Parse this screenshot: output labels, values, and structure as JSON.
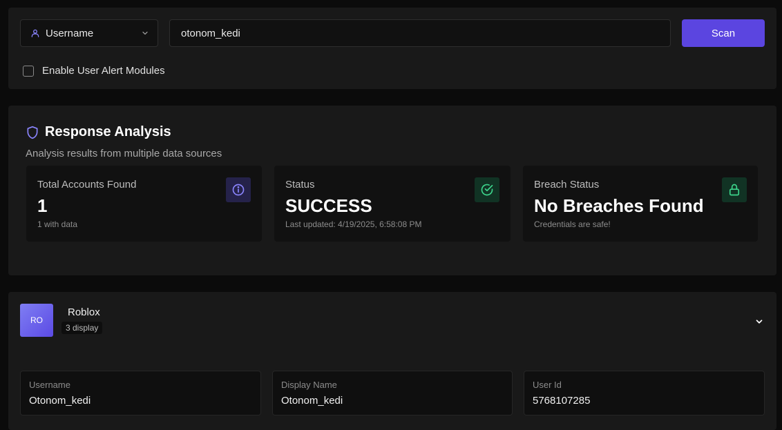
{
  "search": {
    "type_label": "Username",
    "query_value": "otonom_kedi",
    "scan_label": "Scan",
    "alert_label": "Enable User Alert Modules",
    "alert_checked": false
  },
  "analysis": {
    "title": "Response Analysis",
    "subtitle": "Analysis results from multiple data sources",
    "cards": [
      {
        "label": "Total Accounts Found",
        "value": "1",
        "sub": "1 with data",
        "icon": "info-icon"
      },
      {
        "label": "Status",
        "value": "SUCCESS",
        "sub": "Last updated: 4/19/2025, 6:58:08 PM",
        "icon": "check-circle-icon"
      },
      {
        "label": "Breach Status",
        "value": "No Breaches Found",
        "sub": "Credentials are safe!",
        "icon": "lock-icon"
      }
    ]
  },
  "platform": {
    "avatar_text": "RO",
    "name": "Roblox",
    "badge": "3 display",
    "fields": [
      {
        "label": "Username",
        "value": "Otonom_kedi"
      },
      {
        "label": "Display Name",
        "value": "Otonom_kedi"
      },
      {
        "label": "User Id",
        "value": "5768107285"
      }
    ]
  },
  "colors": {
    "accent": "#5b45e0",
    "background": "#0b0b0b",
    "panel": "#191919",
    "info_icon_bg": "#25224a",
    "success_icon_bg": "#113324",
    "success_green": "#3dd68c"
  }
}
